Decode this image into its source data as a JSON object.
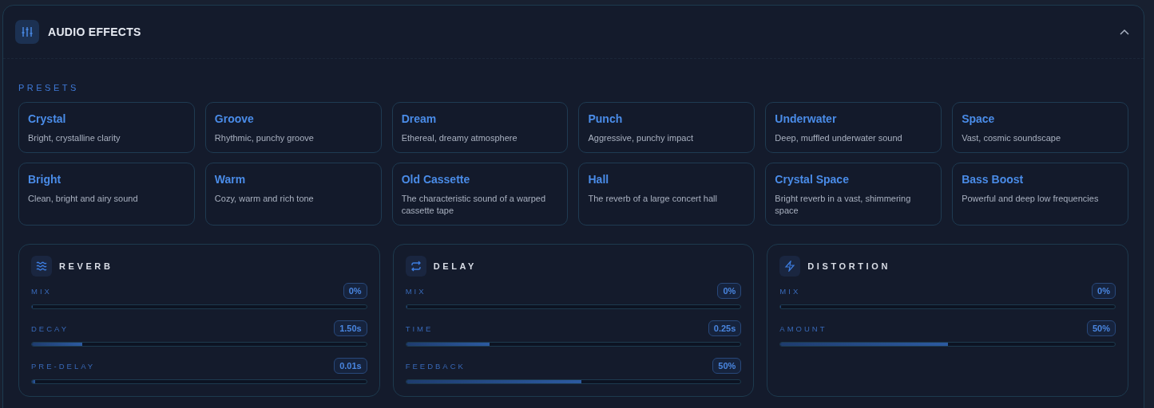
{
  "panel": {
    "title": "AUDIO EFFECTS",
    "expanded": true
  },
  "presets": {
    "heading": "PRESETS",
    "items": [
      {
        "name": "Crystal",
        "description": "Bright, crystalline clarity"
      },
      {
        "name": "Groove",
        "description": "Rhythmic, punchy groove"
      },
      {
        "name": "Dream",
        "description": "Ethereal, dreamy atmosphere"
      },
      {
        "name": "Punch",
        "description": "Aggressive, punchy impact"
      },
      {
        "name": "Underwater",
        "description": "Deep, muffled underwater sound"
      },
      {
        "name": "Space",
        "description": "Vast, cosmic soundscape"
      },
      {
        "name": "Bright",
        "description": "Clean, bright and airy sound"
      },
      {
        "name": "Warm",
        "description": "Cozy, warm and rich tone"
      },
      {
        "name": "Old Cassette",
        "description": "The characteristic sound of a warped cassette tape"
      },
      {
        "name": "Hall",
        "description": "The reverb of a large concert hall"
      },
      {
        "name": "Crystal Space",
        "description": "Bright reverb in a vast, shimmering space"
      },
      {
        "name": "Bass Boost",
        "description": "Powerful and deep low frequencies"
      }
    ]
  },
  "effects": [
    {
      "title": "REVERB",
      "kind": "waves",
      "params": [
        {
          "label": "MIX",
          "reading": "0%",
          "level": 0
        },
        {
          "label": "DECAY",
          "reading": "1.50s",
          "level": 0.15
        },
        {
          "label": "PRE-DELAY",
          "reading": "0.01s",
          "level": 0.01
        }
      ]
    },
    {
      "title": "DELAY",
      "kind": "repeat",
      "params": [
        {
          "label": "MIX",
          "reading": "0%",
          "level": 0
        },
        {
          "label": "TIME",
          "reading": "0.25s",
          "level": 0.25
        },
        {
          "label": "FEEDBACK",
          "reading": "50%",
          "level": 0.525
        }
      ]
    },
    {
      "title": "DISTORTION",
      "kind": "bolt",
      "params": [
        {
          "label": "MIX",
          "reading": "0%",
          "level": 0
        },
        {
          "label": "AMOUNT",
          "reading": "50%",
          "level": 0.5
        }
      ]
    }
  ]
}
